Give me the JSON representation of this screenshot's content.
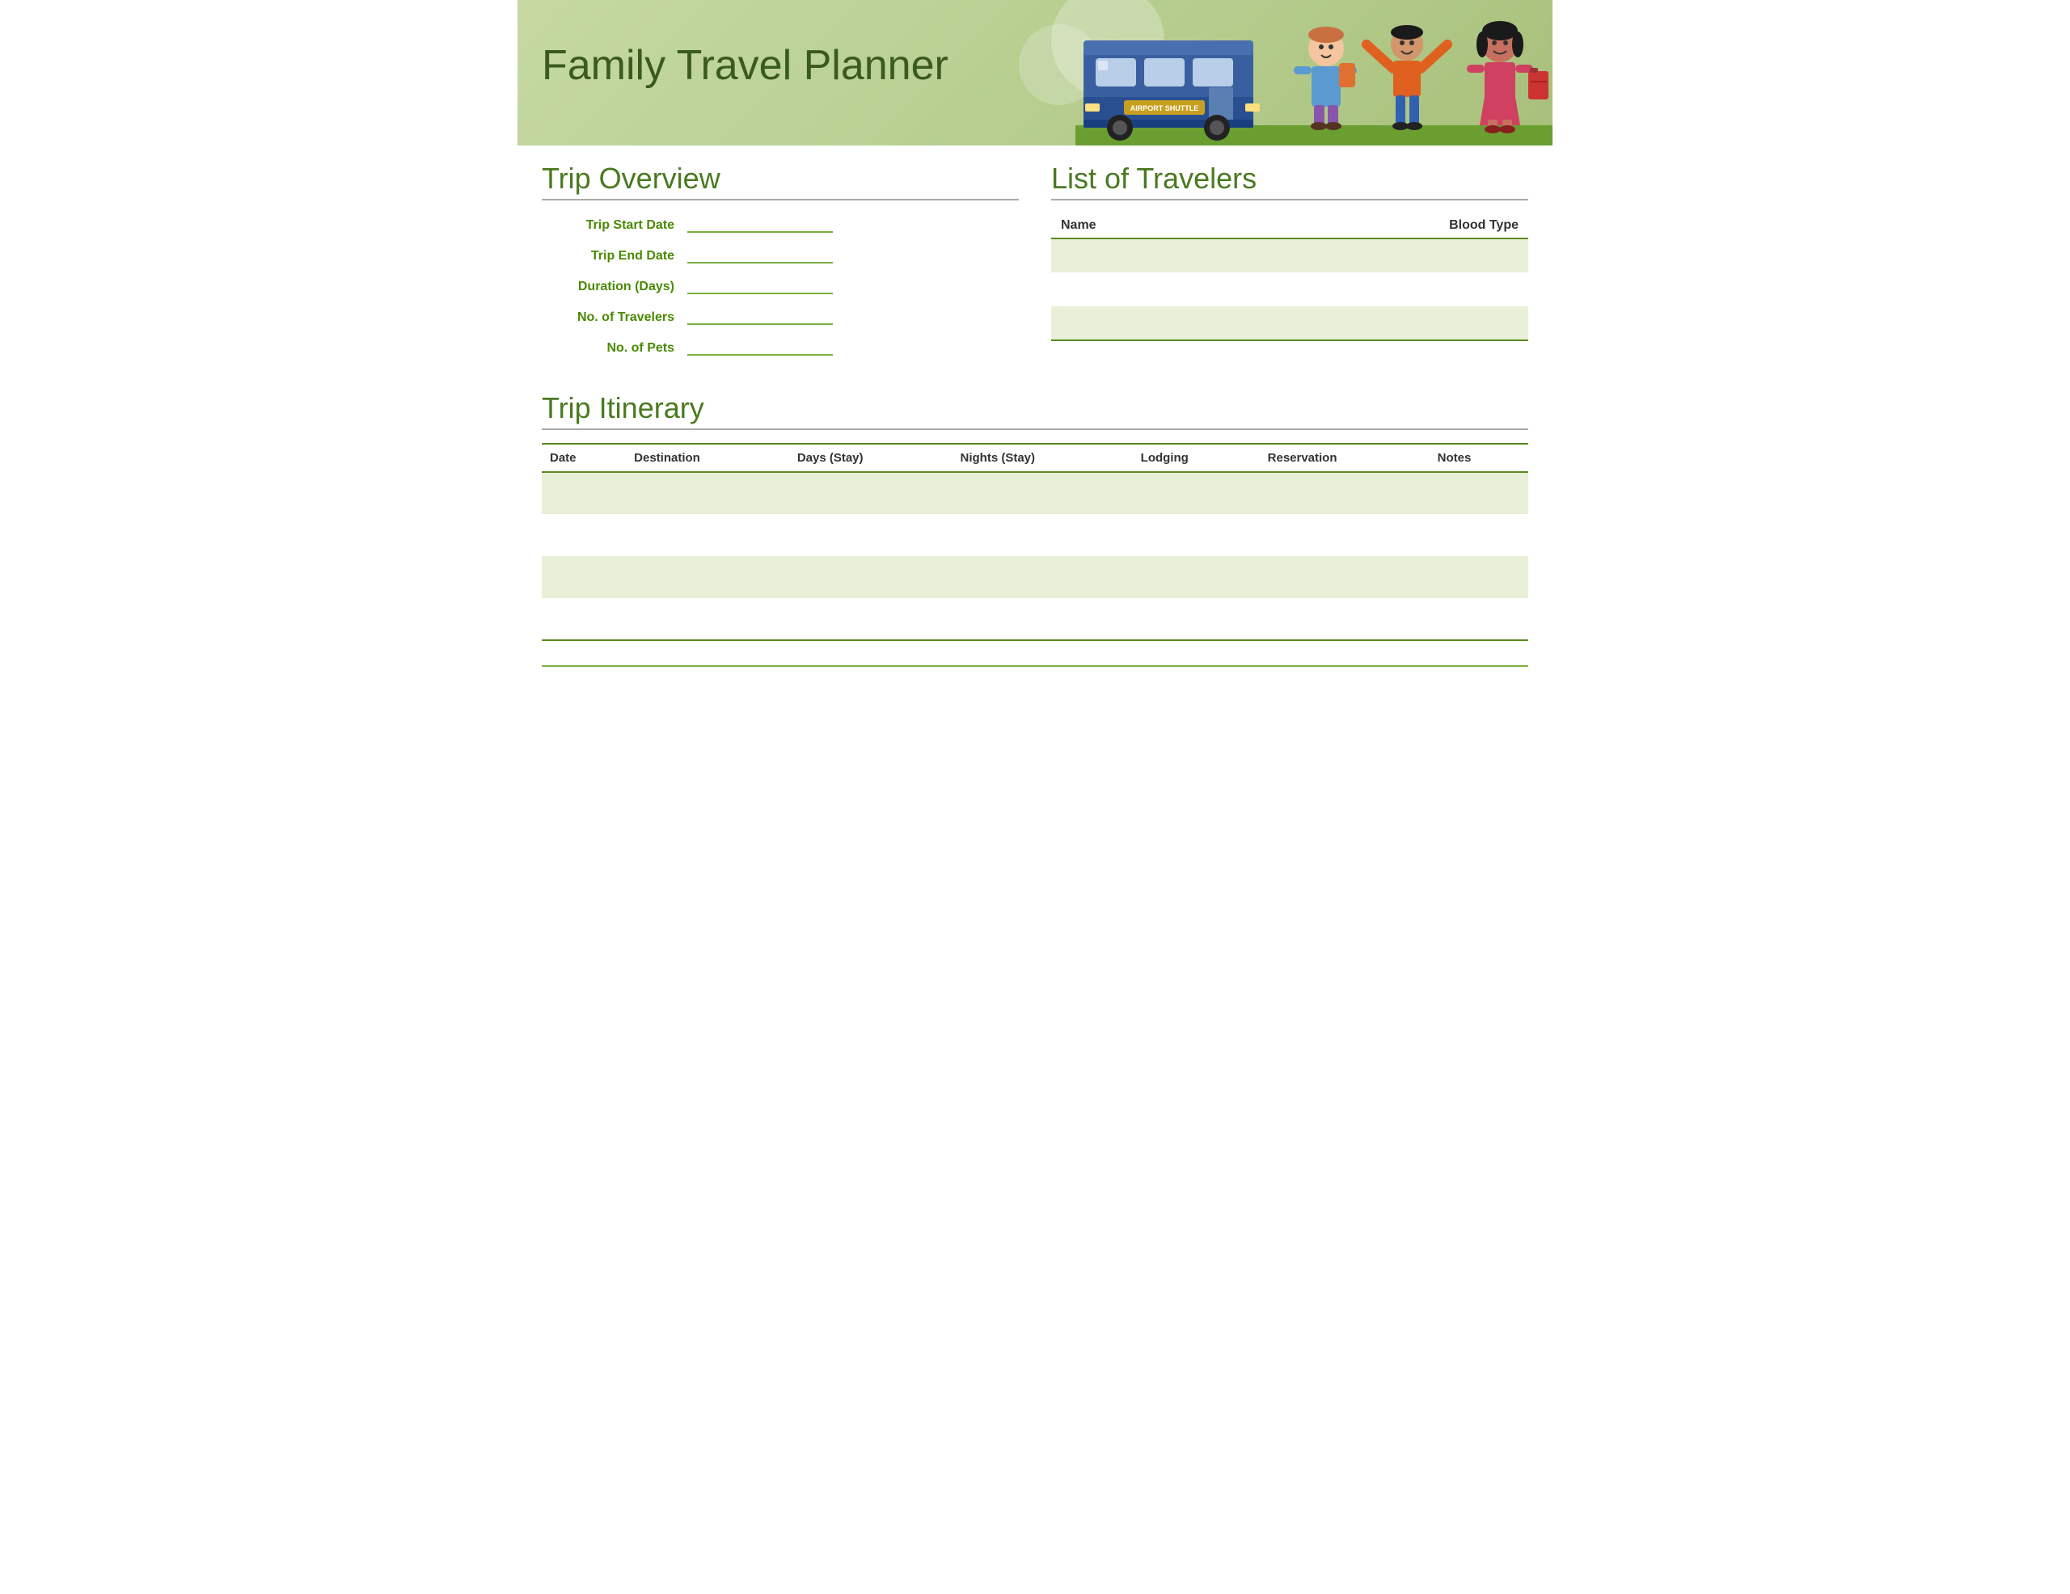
{
  "header": {
    "title": "Family Travel Planner"
  },
  "trip_overview": {
    "section_title": "Trip Overview",
    "fields": [
      {
        "label": "Trip Start Date",
        "value": ""
      },
      {
        "label": "Trip End Date",
        "value": ""
      },
      {
        "label": "Duration (Days)",
        "value": ""
      },
      {
        "label": "No. of Travelers",
        "value": ""
      },
      {
        "label": "No. of Pets",
        "value": ""
      }
    ]
  },
  "travelers": {
    "section_title": "List of Travelers",
    "columns": [
      "Name",
      "Blood Type"
    ],
    "rows": [
      {
        "name": "",
        "blood_type": ""
      },
      {
        "name": "",
        "blood_type": ""
      },
      {
        "name": "",
        "blood_type": ""
      }
    ]
  },
  "itinerary": {
    "section_title": "Trip Itinerary",
    "columns": [
      "Date",
      "Destination",
      "Days (Stay)",
      "Nights (Stay)",
      "Lodging",
      "Reservation",
      "Notes"
    ],
    "rows": [
      {
        "date": "",
        "destination": "",
        "days": "",
        "nights": "",
        "lodging": "",
        "reservation": "",
        "notes": ""
      },
      {
        "date": "",
        "destination": "",
        "days": "",
        "nights": "",
        "lodging": "",
        "reservation": "",
        "notes": ""
      },
      {
        "date": "",
        "destination": "",
        "days": "",
        "nights": "",
        "lodging": "",
        "reservation": "",
        "notes": ""
      },
      {
        "date": "",
        "destination": "",
        "days": "",
        "nights": "",
        "lodging": "",
        "reservation": "",
        "notes": ""
      }
    ]
  },
  "footer": {
    "text": ""
  }
}
